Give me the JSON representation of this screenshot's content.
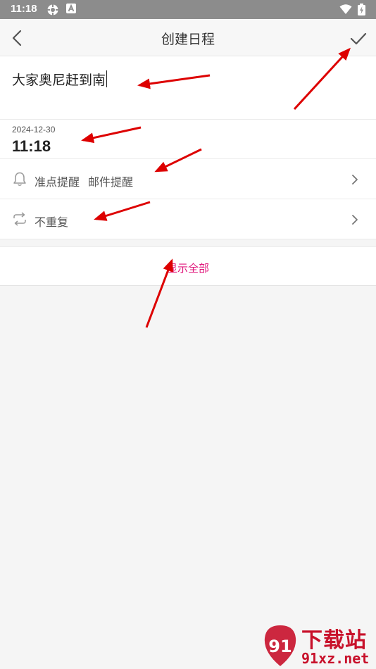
{
  "status_bar": {
    "time": "11:18",
    "icons": [
      "settings-cog-icon",
      "text-a-icon",
      "wifi-icon",
      "battery-charging-icon"
    ]
  },
  "header": {
    "title": "创建日程",
    "back_icon": "chevron-left-icon",
    "confirm_icon": "checkmark-icon"
  },
  "event": {
    "title_value": "大家奥尼赶到南",
    "date": "2024-12-30",
    "time": "11:18"
  },
  "reminder": {
    "icon": "bell-icon",
    "labels": [
      "准点提醒",
      "邮件提醒"
    ]
  },
  "repeat": {
    "icon": "repeat-icon",
    "label": "不重复"
  },
  "show_all": {
    "label": "显示全部"
  },
  "colors": {
    "accent": "#e0157a",
    "status_bar": "#8c8c8c",
    "annotation_arrow": "#dd0000",
    "watermark": "#c8112b"
  },
  "watermark": {
    "logo_text": "91",
    "cn": "下载站",
    "en": "91xz.net"
  }
}
